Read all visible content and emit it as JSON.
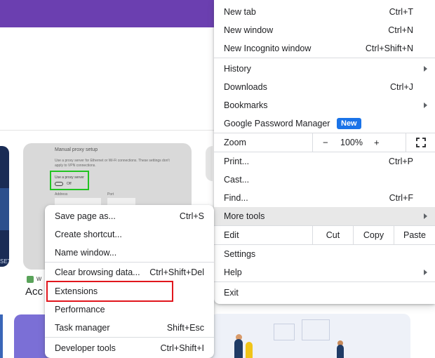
{
  "theme": {
    "topbar_color": "#6b3fb0",
    "new_badge_color": "#1a73e8",
    "highlight_border": "#e1161d",
    "proxy_highlight": "#22c322"
  },
  "background": {
    "card_left_text": "SET",
    "thumbnail": {
      "title": "Manual proxy setup",
      "description": "Use a proxy server for Ethernet or Wi-Fi connections. These settings don't apply to VPN connections.",
      "use_proxy": "Use a proxy server",
      "toggle_state": "Off",
      "address_label": "Address",
      "port_label": "Port"
    },
    "source_text": "w",
    "card_title": "Acc"
  },
  "main_menu": {
    "new_tab": {
      "label": "New tab",
      "shortcut": "Ctrl+T"
    },
    "new_window": {
      "label": "New window",
      "shortcut": "Ctrl+N"
    },
    "new_incognito": {
      "label": "New Incognito window",
      "shortcut": "Ctrl+Shift+N"
    },
    "history": {
      "label": "History"
    },
    "downloads": {
      "label": "Downloads",
      "shortcut": "Ctrl+J"
    },
    "bookmarks": {
      "label": "Bookmarks"
    },
    "password_manager": {
      "label": "Google Password Manager",
      "badge": "New"
    },
    "zoom": {
      "label": "Zoom",
      "minus": "−",
      "level": "100%",
      "plus": "+"
    },
    "print": {
      "label": "Print...",
      "shortcut": "Ctrl+P"
    },
    "cast": {
      "label": "Cast..."
    },
    "find": {
      "label": "Find...",
      "shortcut": "Ctrl+F"
    },
    "more_tools": {
      "label": "More tools"
    },
    "edit": {
      "label": "Edit",
      "cut": "Cut",
      "copy": "Copy",
      "paste": "Paste"
    },
    "settings": {
      "label": "Settings"
    },
    "help": {
      "label": "Help"
    },
    "exit": {
      "label": "Exit"
    }
  },
  "more_tools_menu": {
    "save_page": {
      "label": "Save page as...",
      "shortcut": "Ctrl+S"
    },
    "create_shortcut": {
      "label": "Create shortcut..."
    },
    "name_window": {
      "label": "Name window..."
    },
    "clear_browsing": {
      "label": "Clear browsing data...",
      "shortcut": "Ctrl+Shift+Del"
    },
    "extensions": {
      "label": "Extensions"
    },
    "performance": {
      "label": "Performance"
    },
    "task_manager": {
      "label": "Task manager",
      "shortcut": "Shift+Esc"
    },
    "developer_tools": {
      "label": "Developer tools",
      "shortcut": "Ctrl+Shift+I"
    }
  }
}
